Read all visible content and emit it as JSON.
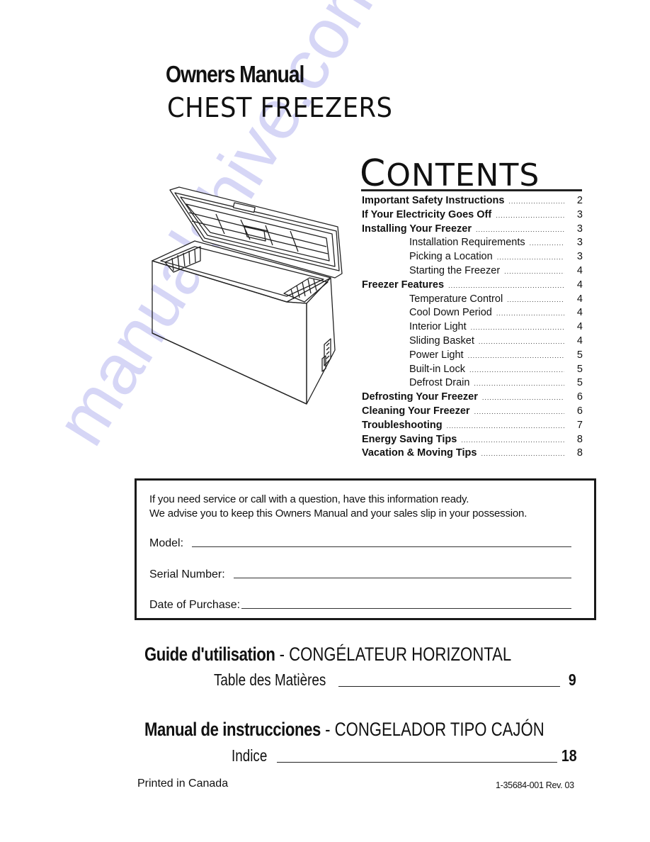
{
  "header": {
    "subtitle": "Owners Manual",
    "title": "CHEST FREEZERS"
  },
  "contents": {
    "heading_first": "C",
    "heading_rest": "ONTENTS",
    "items": [
      {
        "label": "Important Safety Instructions",
        "page": "2",
        "level": "main"
      },
      {
        "label": "If Your Electricity Goes Off",
        "page": "3",
        "level": "main"
      },
      {
        "label": "Installing Your Freezer",
        "page": "3",
        "level": "main"
      },
      {
        "label": "Installation Requirements",
        "page": "3",
        "level": "sub"
      },
      {
        "label": "Picking a Location",
        "page": "3",
        "level": "sub"
      },
      {
        "label": "Starting the Freezer",
        "page": "4",
        "level": "sub"
      },
      {
        "label": "Freezer Features",
        "page": "4",
        "level": "main"
      },
      {
        "label": "Temperature Control",
        "page": "4",
        "level": "sub"
      },
      {
        "label": "Cool Down Period",
        "page": "4",
        "level": "sub"
      },
      {
        "label": "Interior Light",
        "page": "4",
        "level": "sub"
      },
      {
        "label": "Sliding Basket",
        "page": "4",
        "level": "sub"
      },
      {
        "label": "Power Light",
        "page": "5",
        "level": "sub"
      },
      {
        "label": "Built-in Lock",
        "page": "5",
        "level": "sub"
      },
      {
        "label": "Defrost Drain",
        "page": "5",
        "level": "sub"
      },
      {
        "label": "Defrosting Your Freezer",
        "page": "6",
        "level": "main"
      },
      {
        "label": "Cleaning Your Freezer",
        "page": "6",
        "level": "main"
      },
      {
        "label": "Troubleshooting",
        "page": "7",
        "level": "main"
      },
      {
        "label": "Energy Saving Tips",
        "page": "8",
        "level": "main"
      },
      {
        "label": "Vacation & Moving Tips",
        "page": "8",
        "level": "main"
      }
    ]
  },
  "illustration": {
    "icon": "chest-freezer-illustration"
  },
  "info_box": {
    "line1": "If you need service or call with a question, have this information ready.",
    "line2": "We advise you to keep this Owners Manual and your sales slip in your possession.",
    "fields": [
      {
        "label": "Model:",
        "value": ""
      },
      {
        "label": "Serial Number:",
        "value": ""
      },
      {
        "label": "Date of Purchase:",
        "value": ""
      }
    ]
  },
  "french": {
    "title_bold": "Guide d'utilisation",
    "title_rest": " - CONGÉLATEUR HORIZONTAL",
    "toc_label": "Table des Matières",
    "toc_page": "9"
  },
  "spanish": {
    "title_bold": "Manual de instrucciones",
    "title_rest": " - CONGELADOR TIPO CAJÓN",
    "toc_label": "Indice",
    "toc_page": "18"
  },
  "footer": {
    "printed": "Printed in Canada",
    "part_number": "1-35684-001 Rev. 03"
  },
  "watermark": {
    "text": "manualshive.com",
    "color": "#c9c9f4"
  }
}
